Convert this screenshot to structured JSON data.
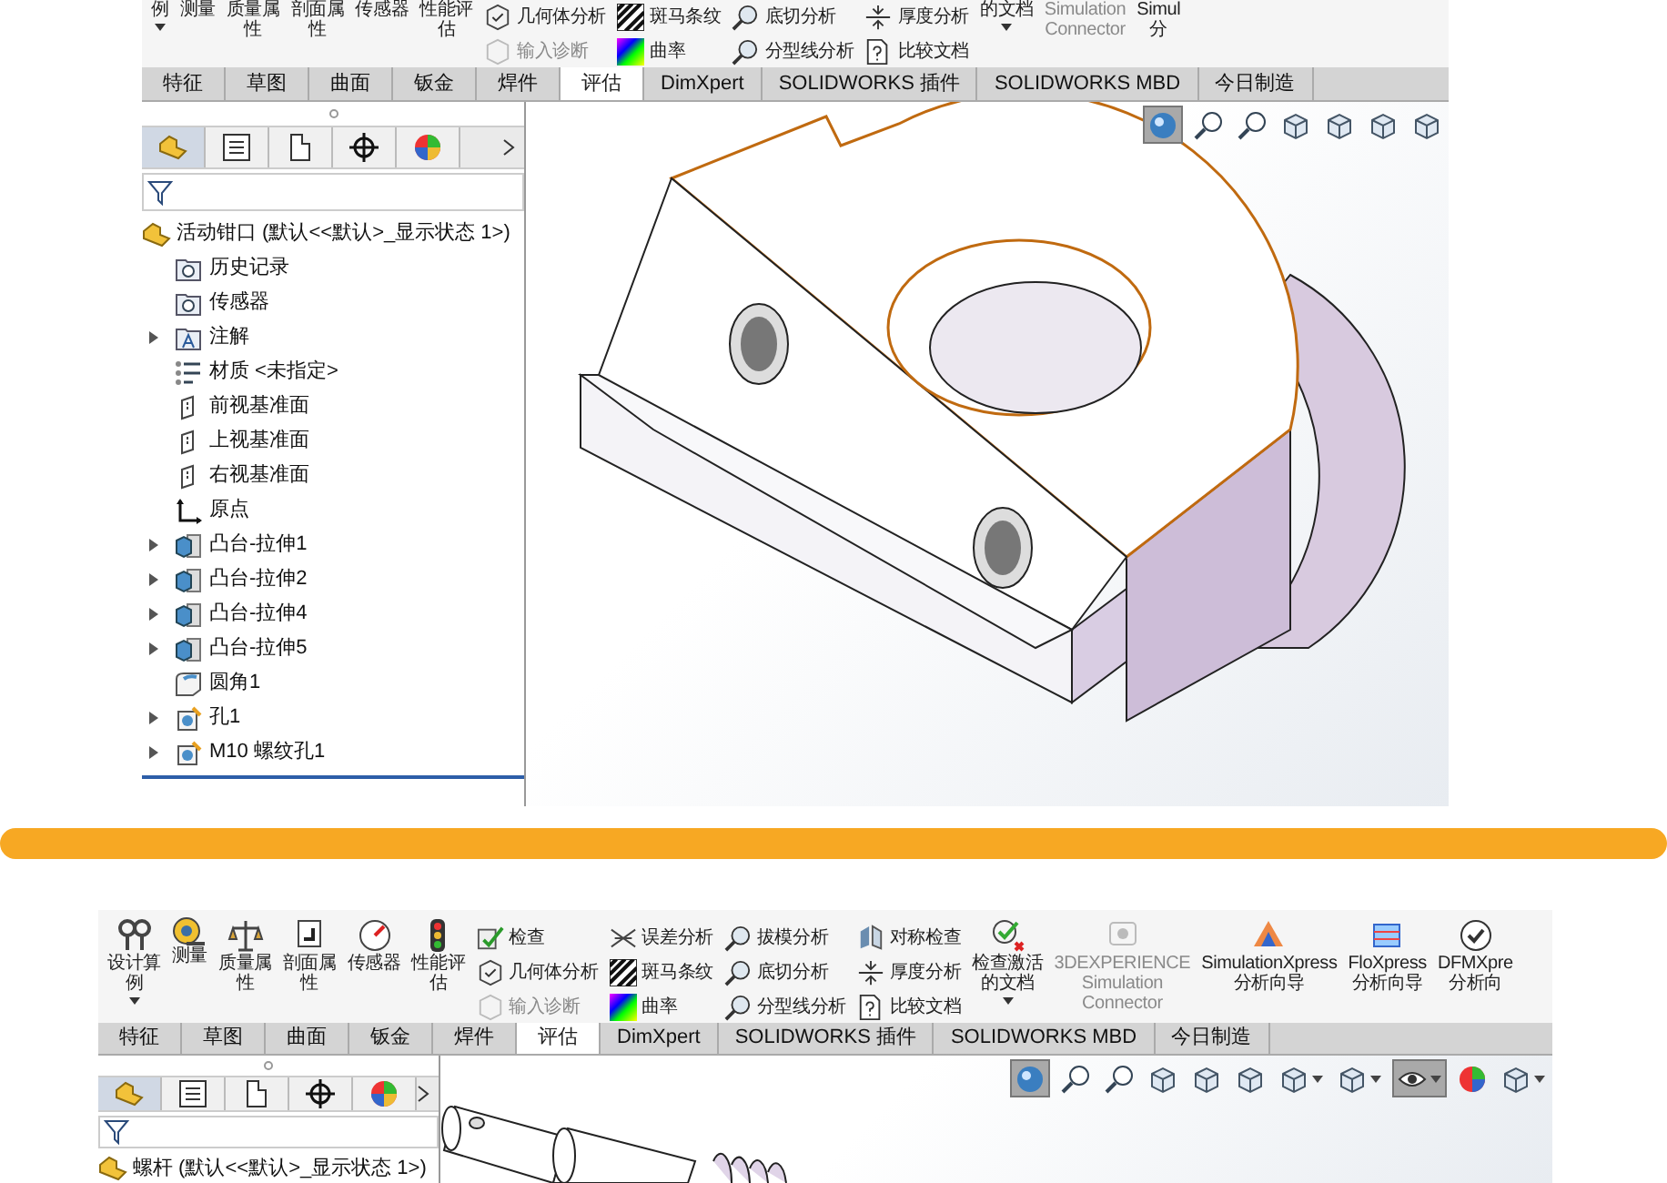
{
  "top": {
    "ribbon": {
      "groups": [
        {
          "kind": "large",
          "lines": [
            "例"
          ],
          "dropdown": true,
          "disabled": false
        },
        {
          "kind": "large",
          "lines": [
            "测量"
          ],
          "dropdown": false,
          "disabled": false
        },
        {
          "kind": "large",
          "lines": [
            "质量属",
            "性"
          ],
          "dropdown": false,
          "disabled": false
        },
        {
          "kind": "large",
          "lines": [
            "剖面属",
            "性"
          ],
          "dropdown": false,
          "disabled": false
        },
        {
          "kind": "large",
          "lines": [
            "传感器"
          ],
          "dropdown": false,
          "disabled": false
        },
        {
          "kind": "large",
          "lines": [
            "性能评",
            "估"
          ],
          "dropdown": false,
          "disabled": false
        },
        {
          "kind": "column",
          "items": [
            {
              "kind": "geometry",
              "label": "几何体分析",
              "disabled": false
            },
            {
              "kind": "import",
              "label": "输入诊断",
              "disabled": true
            }
          ]
        },
        {
          "kind": "column",
          "items": [
            {
              "kind": "zebra",
              "label": "斑马条纹",
              "disabled": false
            },
            {
              "kind": "curvature",
              "label": "曲率",
              "disabled": false
            }
          ]
        },
        {
          "kind": "column",
          "items": [
            {
              "kind": "undercut",
              "label": "底切分析",
              "disabled": false
            },
            {
              "kind": "parting",
              "label": "分型线分析",
              "disabled": false
            }
          ]
        },
        {
          "kind": "column",
          "items": [
            {
              "kind": "thickness",
              "label": "厚度分析",
              "disabled": false
            },
            {
              "kind": "compare",
              "label": "比较文档",
              "disabled": false
            }
          ]
        },
        {
          "kind": "large",
          "lines": [
            "的文档"
          ],
          "dropdown": true,
          "disabled": false
        },
        {
          "kind": "large",
          "lines": [
            "Simulation",
            "Connector"
          ],
          "dropdown": false,
          "disabled": true
        },
        {
          "kind": "large",
          "lines": [
            "Simul",
            "分"
          ],
          "dropdown": false,
          "disabled": false
        }
      ]
    },
    "tabs": [
      {
        "label": "特征",
        "selected": false
      },
      {
        "label": "草图",
        "selected": false
      },
      {
        "label": "曲面",
        "selected": false
      },
      {
        "label": "钣金",
        "selected": false
      },
      {
        "label": "焊件",
        "selected": false
      },
      {
        "label": "评估",
        "selected": true
      },
      {
        "label": "DimXpert",
        "selected": false
      },
      {
        "label": "SOLIDWORKS 插件",
        "selected": false
      },
      {
        "label": "SOLIDWORKS MBD",
        "selected": false
      },
      {
        "label": "今日制造",
        "selected": false
      }
    ],
    "panel_tabs": [
      {
        "kind": "features",
        "selected": true
      },
      {
        "kind": "properties",
        "selected": false
      },
      {
        "kind": "configurations",
        "selected": false
      },
      {
        "kind": "dimxpert",
        "selected": false
      },
      {
        "kind": "display",
        "selected": false
      }
    ],
    "view_tools": [
      {
        "kind": "shaded",
        "selected": true,
        "dropdown": false
      },
      {
        "kind": "zoom",
        "selected": false,
        "dropdown": false
      },
      {
        "kind": "zoom-area",
        "selected": false,
        "dropdown": false
      },
      {
        "kind": "previous",
        "selected": false,
        "dropdown": false
      },
      {
        "kind": "section",
        "selected": false,
        "dropdown": false
      },
      {
        "kind": "dynamic",
        "selected": false,
        "dropdown": false
      },
      {
        "kind": "orientation",
        "selected": false,
        "dropdown": false
      }
    ],
    "tree": {
      "root": "活动钳口 (默认<<默认>_显示状态 1>)",
      "children": [
        {
          "label": "历史记录",
          "kind": "history",
          "expandable": false
        },
        {
          "label": "传感器",
          "kind": "sensor",
          "expandable": false
        },
        {
          "label": "注解",
          "kind": "annotation",
          "expandable": true
        },
        {
          "label": "材质 <未指定>",
          "kind": "material",
          "expandable": false
        },
        {
          "label": "前视基准面",
          "kind": "plane",
          "expandable": false
        },
        {
          "label": "上视基准面",
          "kind": "plane",
          "expandable": false
        },
        {
          "label": "右视基准面",
          "kind": "plane",
          "expandable": false
        },
        {
          "label": "原点",
          "kind": "origin",
          "expandable": false
        },
        {
          "label": "凸台-拉伸1",
          "kind": "extrude",
          "expandable": true
        },
        {
          "label": "凸台-拉伸2",
          "kind": "extrude",
          "expandable": true
        },
        {
          "label": "凸台-拉伸4",
          "kind": "extrude",
          "expandable": true
        },
        {
          "label": "凸台-拉伸5",
          "kind": "extrude",
          "expandable": true
        },
        {
          "label": "圆角1",
          "kind": "fillet",
          "expandable": false
        },
        {
          "label": "孔1",
          "kind": "hole",
          "expandable": true
        },
        {
          "label": "M10 螺纹孔1",
          "kind": "hole",
          "expandable": true
        }
      ]
    }
  },
  "bottom": {
    "ribbon": {
      "groups": [
        {
          "kind": "large",
          "lines": [
            "设计算",
            "例"
          ],
          "dropdown": true,
          "disabled": false
        },
        {
          "kind": "large",
          "lines": [
            "测量"
          ],
          "dropdown": false,
          "disabled": false
        },
        {
          "kind": "large",
          "lines": [
            "质量属",
            "性"
          ],
          "dropdown": false,
          "disabled": false
        },
        {
          "kind": "large",
          "lines": [
            "剖面属",
            "性"
          ],
          "dropdown": false,
          "disabled": false
        },
        {
          "kind": "large",
          "lines": [
            "传感器"
          ],
          "dropdown": false,
          "disabled": false
        },
        {
          "kind": "large",
          "lines": [
            "性能评",
            "估"
          ],
          "dropdown": false,
          "disabled": false
        },
        {
          "kind": "column",
          "items": [
            {
              "kind": "check",
              "label": "检查",
              "disabled": false
            },
            {
              "kind": "geometry",
              "label": "几何体分析",
              "disabled": false
            },
            {
              "kind": "import",
              "label": "输入诊断",
              "disabled": true
            }
          ]
        },
        {
          "kind": "column",
          "items": [
            {
              "kind": "deviation",
              "label": "误差分析",
              "disabled": false
            },
            {
              "kind": "zebra",
              "label": "斑马条纹",
              "disabled": false
            },
            {
              "kind": "curvature",
              "label": "曲率",
              "disabled": false
            }
          ]
        },
        {
          "kind": "column",
          "items": [
            {
              "kind": "draft",
              "label": "拔模分析",
              "disabled": false
            },
            {
              "kind": "undercut",
              "label": "底切分析",
              "disabled": false
            },
            {
              "kind": "parting",
              "label": "分型线分析",
              "disabled": false
            }
          ]
        },
        {
          "kind": "column",
          "items": [
            {
              "kind": "symmetry",
              "label": "对称检查",
              "disabled": false
            },
            {
              "kind": "thickness",
              "label": "厚度分析",
              "disabled": false
            },
            {
              "kind": "compare",
              "label": "比较文档",
              "disabled": false
            }
          ]
        },
        {
          "kind": "large",
          "lines": [
            "检查激活",
            "的文档"
          ],
          "dropdown": true,
          "disabled": false
        },
        {
          "kind": "large",
          "lines": [
            "3DEXPERIENCE",
            "Simulation",
            "Connector"
          ],
          "dropdown": false,
          "disabled": true
        },
        {
          "kind": "large",
          "lines": [
            "SimulationXpress",
            "分析向导"
          ],
          "dropdown": false,
          "disabled": false
        },
        {
          "kind": "large",
          "lines": [
            "FloXpress",
            "分析向导"
          ],
          "dropdown": false,
          "disabled": false
        },
        {
          "kind": "large",
          "lines": [
            "DFMXpre",
            "分析向"
          ],
          "dropdown": false,
          "disabled": false
        }
      ]
    },
    "tabs": [
      {
        "label": "特征",
        "selected": false
      },
      {
        "label": "草图",
        "selected": false
      },
      {
        "label": "曲面",
        "selected": false
      },
      {
        "label": "钣金",
        "selected": false
      },
      {
        "label": "焊件",
        "selected": false
      },
      {
        "label": "评估",
        "selected": true
      },
      {
        "label": "DimXpert",
        "selected": false
      },
      {
        "label": "SOLIDWORKS 插件",
        "selected": false
      },
      {
        "label": "SOLIDWORKS MBD",
        "selected": false
      },
      {
        "label": "今日制造",
        "selected": false
      }
    ],
    "panel_tabs": [
      {
        "kind": "features",
        "selected": true
      },
      {
        "kind": "properties",
        "selected": false
      },
      {
        "kind": "configurations",
        "selected": false
      },
      {
        "kind": "dimxpert",
        "selected": false
      },
      {
        "kind": "display",
        "selected": false
      }
    ],
    "view_tools": [
      {
        "kind": "shaded",
        "selected": true,
        "dropdown": false
      },
      {
        "kind": "zoom",
        "selected": false,
        "dropdown": false
      },
      {
        "kind": "zoom-area",
        "selected": false,
        "dropdown": false
      },
      {
        "kind": "previous",
        "selected": false,
        "dropdown": false
      },
      {
        "kind": "section",
        "selected": false,
        "dropdown": false
      },
      {
        "kind": "dynamic",
        "selected": false,
        "dropdown": false
      },
      {
        "kind": "orientation",
        "selected": false,
        "dropdown": true
      },
      {
        "kind": "display-style",
        "selected": false,
        "dropdown": true
      },
      {
        "kind": "hide-show",
        "selected": true,
        "dropdown": true
      },
      {
        "kind": "appearance",
        "selected": false,
        "dropdown": false
      },
      {
        "kind": "scene",
        "selected": false,
        "dropdown": true
      }
    ],
    "tree": {
      "root": "螺杆 (默认<<默认>_显示状态 1>)"
    }
  }
}
